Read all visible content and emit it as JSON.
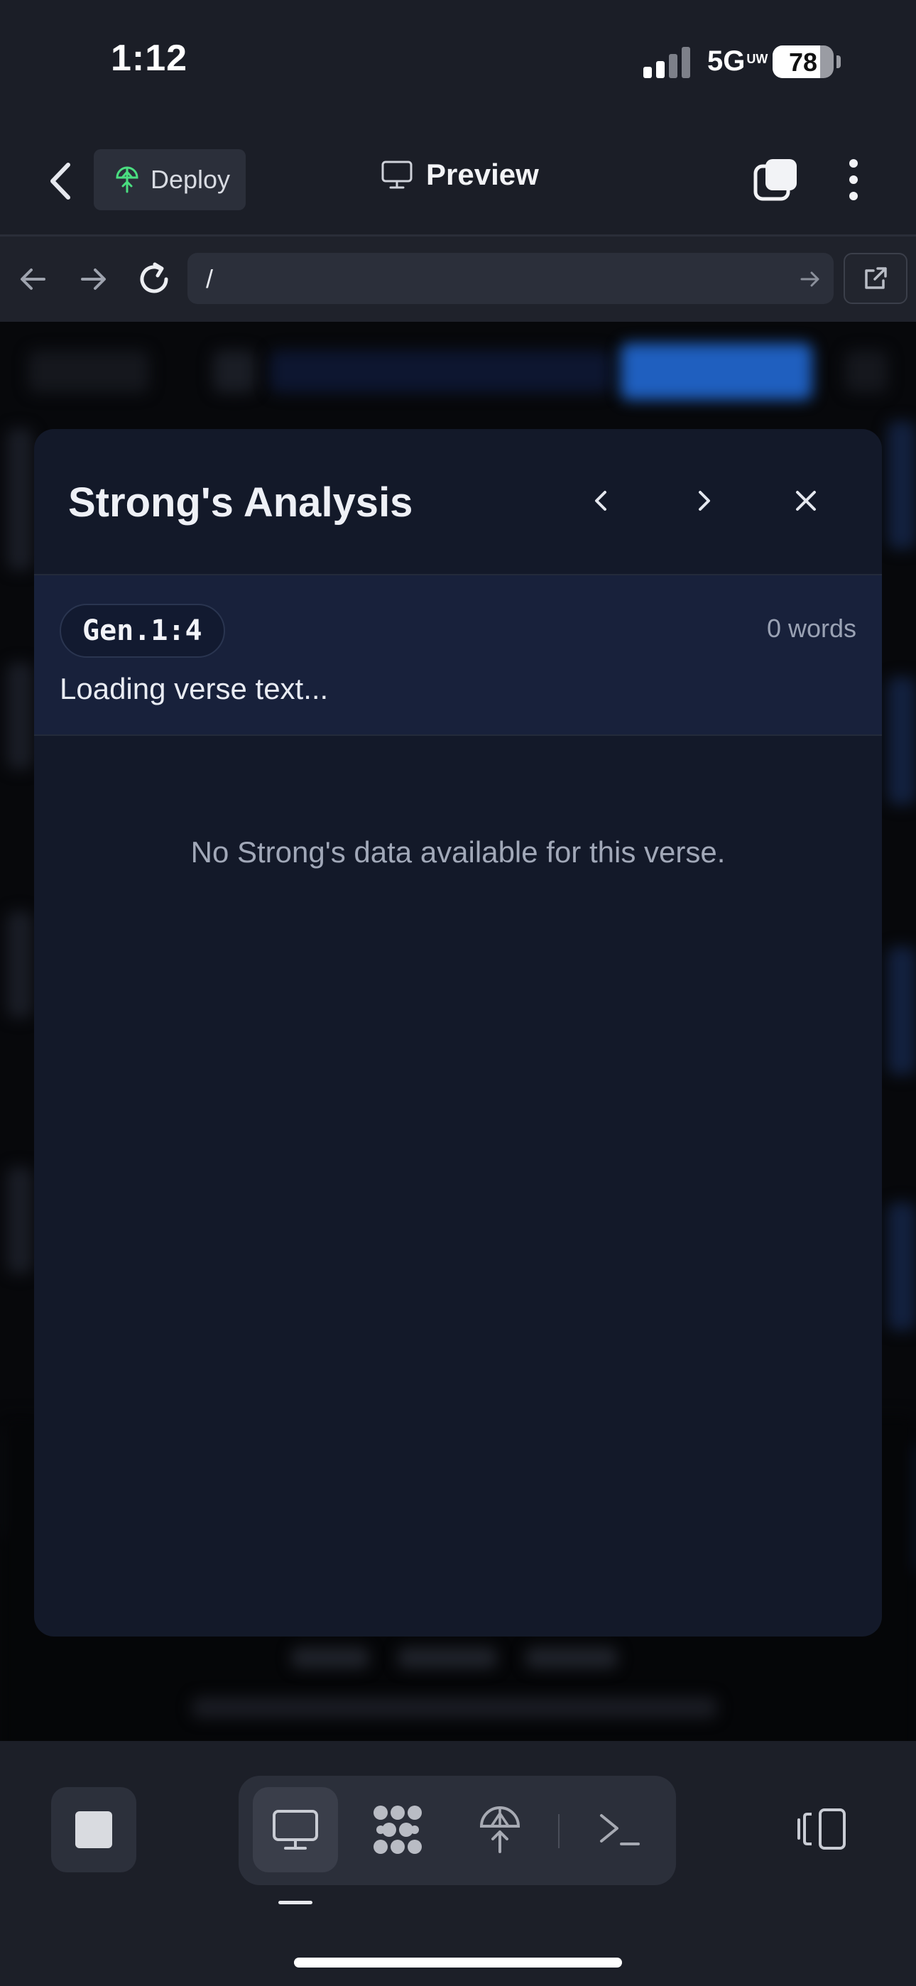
{
  "status_bar": {
    "time": "1:12",
    "network": "5G",
    "network_sub": "UW",
    "battery": "78",
    "battery_level": 0.78
  },
  "header": {
    "deploy_label": "Deploy",
    "title": "Preview"
  },
  "browser": {
    "url": "/"
  },
  "modal": {
    "title": "Strong's Analysis",
    "verse_ref": "Gen.1:4",
    "word_count": "0 words",
    "verse_text": "Loading verse text...",
    "empty_message": "No Strong's data available for this verse."
  },
  "colors": {
    "background": "#1b1e27",
    "modal_bg": "#131929",
    "verse_block_bg": "#18213b",
    "deploy_icon": "#4ade80"
  },
  "icons": [
    "chevron-left-icon",
    "deploy-icon",
    "monitor-icon",
    "tabs-icon",
    "more-vertical-icon",
    "arrow-left-icon",
    "arrow-right-icon",
    "reload-icon",
    "external-link-icon",
    "close-icon",
    "stop-icon",
    "ai-agent-icon",
    "terminal-icon",
    "layout-toggle-icon"
  ]
}
